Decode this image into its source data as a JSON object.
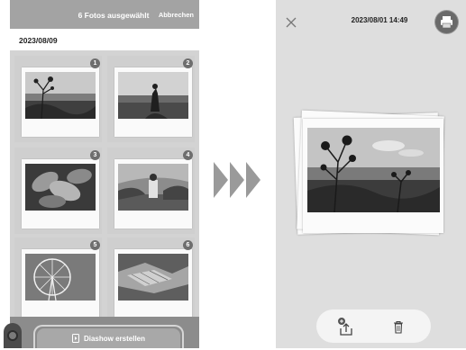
{
  "left_screen": {
    "header": {
      "title": "6 Fotos ausgewählt",
      "cancel_label": "Abbrechen"
    },
    "date_label": "2023/08/09",
    "photos": [
      {
        "badge": "1",
        "subject": "wildflowers-by-sea"
      },
      {
        "badge": "2",
        "subject": "person-on-beach"
      },
      {
        "badge": "3",
        "subject": "succulent-closeup"
      },
      {
        "badge": "4",
        "subject": "person-in-garden"
      },
      {
        "badge": "5",
        "subject": "ferris-wheel"
      },
      {
        "badge": "6",
        "subject": "picnic-blankets"
      }
    ],
    "slideshow_button_label": "Diashow erstellen",
    "slideshow_icon": "slideshow-icon"
  },
  "right_screen": {
    "timestamp": "2023/08/01 14:49",
    "printer_icon": "printer-icon",
    "close_icon": "close-icon",
    "actions": [
      {
        "name": "share",
        "icon": "share-icon"
      },
      {
        "name": "delete",
        "icon": "trash-icon"
      }
    ]
  },
  "transition_icon": "triple-chevron-right-icon",
  "colors": {
    "header_bg": "#a3a3a3",
    "badge_bg": "#6e6e6e",
    "button_bg": "#a8a8a8",
    "arrow": "#9a9a9a"
  }
}
